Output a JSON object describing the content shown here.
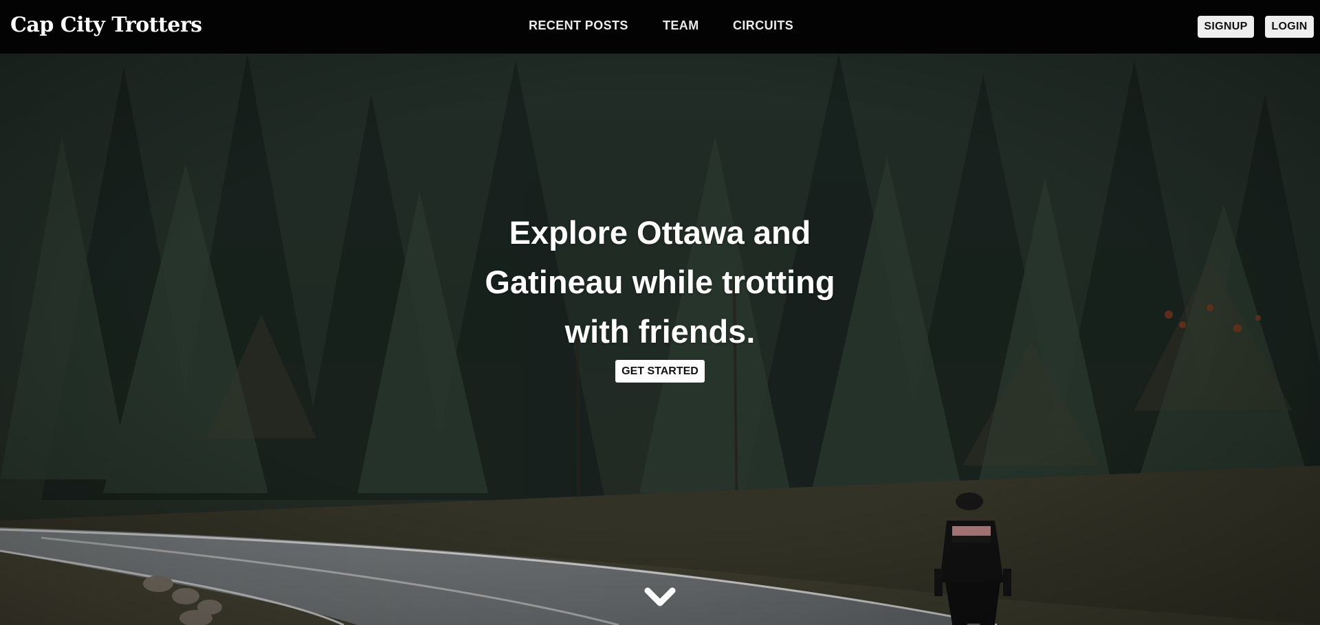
{
  "navbar": {
    "brand": "Cap City Trotters",
    "links": [
      {
        "label": "RECENT POSTS"
      },
      {
        "label": "TEAM"
      },
      {
        "label": "CIRCUITS"
      }
    ],
    "signup_label": "SIGNUP",
    "login_label": "LOGIN",
    "background": "#030303"
  },
  "hero": {
    "headline": "Explore Ottawa and Gatineau while trotting with friends.",
    "cta_label": "GET STARTED",
    "scroll_icon": "chevron-down-icon",
    "background_image": "forest road with cyclist"
  },
  "colors": {
    "text": "#ffffff",
    "button_bg": "#eeeeee",
    "forest_dark": "#1f2a24",
    "road": "#7b7f82"
  }
}
